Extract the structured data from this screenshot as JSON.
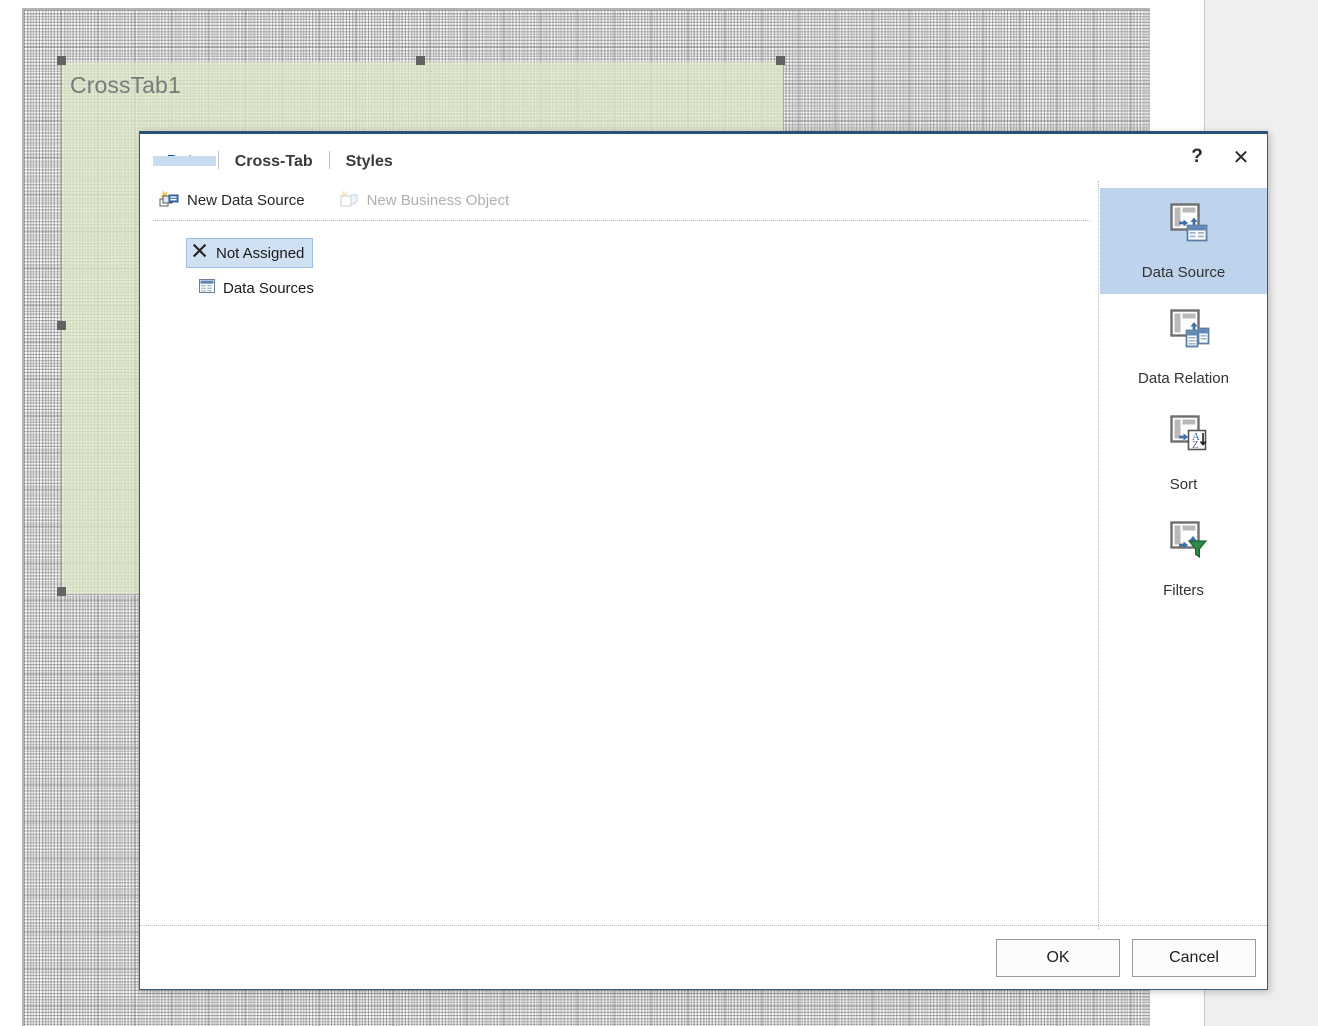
{
  "canvas": {
    "element_label": "CrossTab1"
  },
  "dialog": {
    "tabs": [
      {
        "label": "Data",
        "active": true
      },
      {
        "label": "Cross-Tab",
        "active": false
      },
      {
        "label": "Styles",
        "active": false
      }
    ],
    "window_buttons": {
      "help": "?",
      "close": "✕"
    },
    "toolbar": [
      {
        "label": "New Data Source",
        "icon": "new-data-source-icon",
        "disabled": false
      },
      {
        "label": "New Business Object",
        "icon": "new-business-object-icon",
        "disabled": true
      }
    ],
    "tree": [
      {
        "label": "Not Assigned",
        "icon": "not-assigned-icon",
        "selected": true
      },
      {
        "label": "Data Sources",
        "icon": "data-sources-icon",
        "selected": false
      }
    ],
    "rail": [
      {
        "label": "Data Source",
        "icon": "data-source-icon",
        "active": true
      },
      {
        "label": "Data Relation",
        "icon": "data-relation-icon",
        "active": false
      },
      {
        "label": "Sort",
        "icon": "sort-icon",
        "active": false
      },
      {
        "label": "Filters",
        "icon": "filters-icon",
        "active": false
      }
    ],
    "footer": {
      "ok_label": "OK",
      "cancel_label": "Cancel"
    }
  },
  "colors": {
    "accent_blue": "#1c4b8f",
    "dialog_border": "#2d5079",
    "selection_blue": "#cfe0f2",
    "rail_active": "#bed3ec",
    "element_green": "#dfebc8"
  }
}
